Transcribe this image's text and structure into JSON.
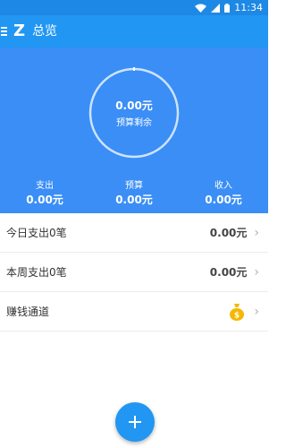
{
  "status_bar": {
    "time": "11:34",
    "icons": [
      "wifi-icon",
      "signal-icon",
      "battery-icon"
    ]
  },
  "app_bar": {
    "menu_icon": "menu-icon",
    "logo": "Z",
    "title": "总览"
  },
  "summary": {
    "budget_remaining_amount": "0.00元",
    "budget_remaining_label": "预算剩余",
    "stats": [
      {
        "label": "支出",
        "value": "0.00元"
      },
      {
        "label": "预算",
        "value": "0.00元"
      },
      {
        "label": "收入",
        "value": "0.00元"
      }
    ]
  },
  "list": [
    {
      "label": "今日支出0笔",
      "value": "0.00元"
    },
    {
      "label": "本周支出0笔",
      "value": "0.00元"
    },
    {
      "label": "赚钱通道",
      "icon": "money-bag-icon"
    }
  ],
  "fab": {
    "icon": "plus-icon"
  },
  "colors": {
    "status_bar": "#1e88e5",
    "app_bar": "#2196f3",
    "summary_bg": "#3a8ef6",
    "accent": "#2196f3",
    "coin": "#f5b800"
  }
}
